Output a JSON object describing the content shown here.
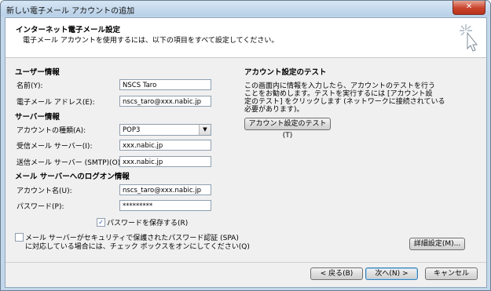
{
  "window": {
    "title": "新しい電子メール アカウントの追加",
    "close_label": "✕"
  },
  "header": {
    "title": "インターネット電子メール設定",
    "subtitle": "電子メール アカウントを使用するには、以下の項目をすべて設定してください。"
  },
  "user_info": {
    "heading": "ユーザー情報",
    "name_label": "名前(Y):",
    "name_value": "NSCS Taro",
    "email_label": "電子メール アドレス(E):",
    "email_value": "nscs_taro@xxx.nabic.jp"
  },
  "server_info": {
    "heading": "サーバー情報",
    "type_label": "アカウントの種類(A):",
    "type_value": "POP3",
    "incoming_label": "受信メール サーバー(I):",
    "incoming_value": "xxx.nabic.jp",
    "outgoing_label": "送信メール サーバー (SMTP)(O):",
    "outgoing_value": "xxx.nabic.jp"
  },
  "logon_info": {
    "heading": "メール サーバーへのログオン情報",
    "account_label": "アカウント名(U):",
    "account_value": "nscs_taro@xxx.nabic.jp",
    "password_label": "パスワード(P):",
    "password_value": "*********",
    "save_password_label": "パスワードを保存する(R)",
    "save_password_checked": true,
    "spa_line1": "メール サーバーがセキュリティで保護されたパスワード認証 (SPA)",
    "spa_line2": "に対応している場合には、チェック ボックスをオンにしてください(Q)",
    "spa_checked": false
  },
  "test": {
    "heading": "アカウント設定のテスト",
    "line1": "この画面内に情報を入力したら、アカウントのテストを行う",
    "line2": "ことをお勧めします。テストを実行するには [アカウント設",
    "line3": "定のテスト] をクリックします (ネットワークに接続されている",
    "line4": "必要があります)。",
    "button_label": "アカウント設定のテスト(T)"
  },
  "buttons": {
    "advanced": "詳細設定(M)...",
    "back": "< 戻る(B)",
    "next": "次へ(N) >",
    "cancel": "キャンセル"
  }
}
